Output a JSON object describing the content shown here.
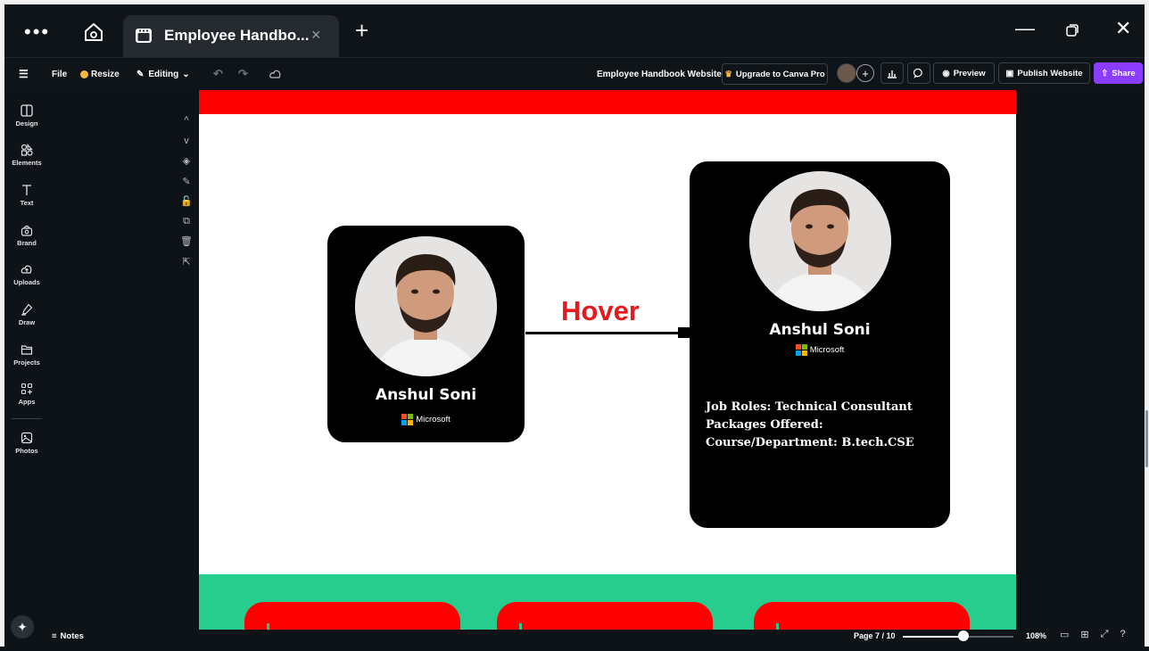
{
  "window": {
    "more_label": "•••",
    "tab_title": "Employee Handbo...",
    "tab_close": "×",
    "new_tab": "+",
    "minimize": "—",
    "close": "✕"
  },
  "toolbar": {
    "menu_icon": "☰",
    "file": "File",
    "resize": "Resize",
    "editing": "Editing",
    "undo": "↶",
    "redo": "↷",
    "doc_title": "Employee Handbook Website",
    "upgrade": "Upgrade to Canva Pro",
    "plus": "+",
    "preview": "Preview",
    "publish": "Publish Website",
    "share": "Share"
  },
  "sidebar": {
    "items": [
      {
        "label": "Design",
        "icon": "design-icon"
      },
      {
        "label": "Elements",
        "icon": "elements-icon"
      },
      {
        "label": "Text",
        "icon": "text-icon"
      },
      {
        "label": "Brand",
        "icon": "brand-icon"
      },
      {
        "label": "Uploads",
        "icon": "uploads-icon"
      },
      {
        "label": "Draw",
        "icon": "draw-icon"
      },
      {
        "label": "Projects",
        "icon": "projects-icon"
      },
      {
        "label": "Apps",
        "icon": "apps-icon"
      },
      {
        "label": "Photos",
        "icon": "photos-icon"
      }
    ]
  },
  "page_tools": [
    "^",
    "v",
    "◈",
    "✎",
    "🔓",
    "⧉",
    "🗑",
    "⇱"
  ],
  "canvas": {
    "hover_label": "Hover",
    "card_small": {
      "name": "Anshul Soni",
      "company": "Microsoft"
    },
    "card_large": {
      "name": "Anshul Soni",
      "company": "Microsoft",
      "job_roles": "Job Roles:  Technical Consultant",
      "packages": "Packages Offered:",
      "course": "Course/Department: B.tech.CSE"
    }
  },
  "status": {
    "notes": "Notes",
    "page": "Page 7 / 10",
    "zoom": "108%",
    "zoom_level": 0.55
  },
  "colors": {
    "accent": "#8b3dff",
    "banner_red": "#ff0000",
    "banner_green": "#27cd8f",
    "hover_red": "#e8191d"
  }
}
